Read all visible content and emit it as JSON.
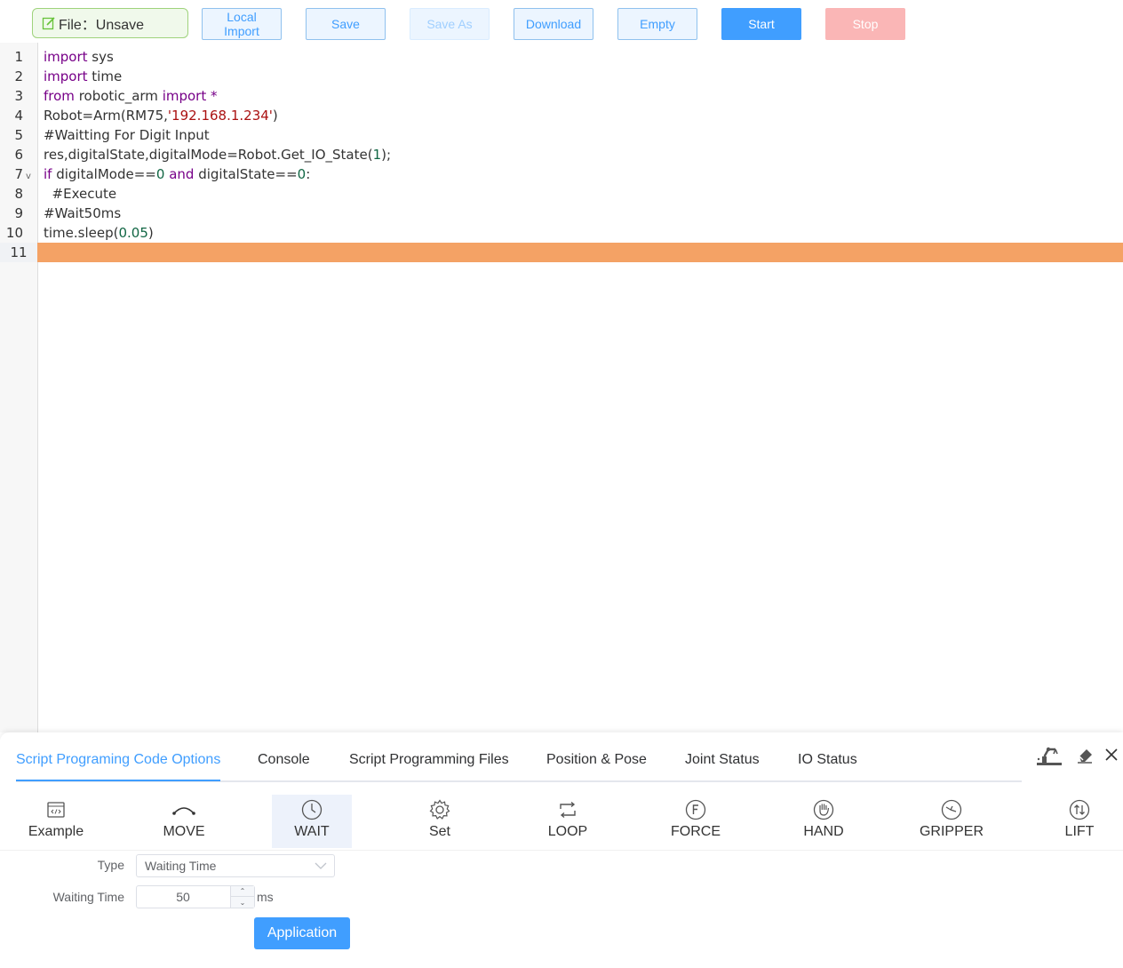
{
  "toolbar": {
    "file_label": "File：Unsave",
    "buttons": [
      "Local Import",
      "Save",
      "Save As",
      "Download",
      "Empty",
      "Start",
      "Stop"
    ]
  },
  "editor": {
    "lines": [
      {
        "n": "1",
        "code": "import sys"
      },
      {
        "n": "2",
        "code": "import time"
      },
      {
        "n": "3",
        "code": "from robotic_arm import *"
      },
      {
        "n": "4",
        "code": "Robot=Arm(RM75,'192.168.1.234')"
      },
      {
        "n": "5",
        "code": "#Waitting For Digit Input"
      },
      {
        "n": "6",
        "code": "res,digitalState,digitalMode=Robot.Get_IO_State(1);"
      },
      {
        "n": "7",
        "code": "if digitalMode==0 and digitalState==0:"
      },
      {
        "n": "8",
        "code": "  #Execute"
      },
      {
        "n": "9",
        "code": "#Wait50ms"
      },
      {
        "n": "10",
        "code": "time.sleep(0.05)"
      },
      {
        "n": "11",
        "code": ""
      }
    ],
    "active_line": "11"
  },
  "panel": {
    "tabs": [
      "Script Programing Code Options",
      "Console",
      "Script Programming Files",
      "Position & Pose",
      "Joint Status",
      "IO Status"
    ],
    "options": [
      {
        "label": "Example",
        "icon": "code-file-icon"
      },
      {
        "label": "MOVE",
        "icon": "arc-move-icon"
      },
      {
        "label": "WAIT",
        "icon": "clock-icon"
      },
      {
        "label": "Set",
        "icon": "gear-icon"
      },
      {
        "label": "LOOP",
        "icon": "loop-icon"
      },
      {
        "label": "FORCE",
        "icon": "force-icon"
      },
      {
        "label": "HAND",
        "icon": "hand-icon"
      },
      {
        "label": "GRIPPER",
        "icon": "gripper-icon"
      },
      {
        "label": "LIFT",
        "icon": "lift-icon"
      }
    ],
    "form": {
      "type_label": "Type",
      "type_value": "Waiting Time",
      "time_label": "Waiting Time",
      "time_value": "50",
      "unit": "ms",
      "apply_label": "Application"
    }
  },
  "colors": {
    "accent": "#409eff",
    "active_line": "#f4a265",
    "stop": "#fab6b6",
    "file_tag_border": "#9fd37c"
  }
}
